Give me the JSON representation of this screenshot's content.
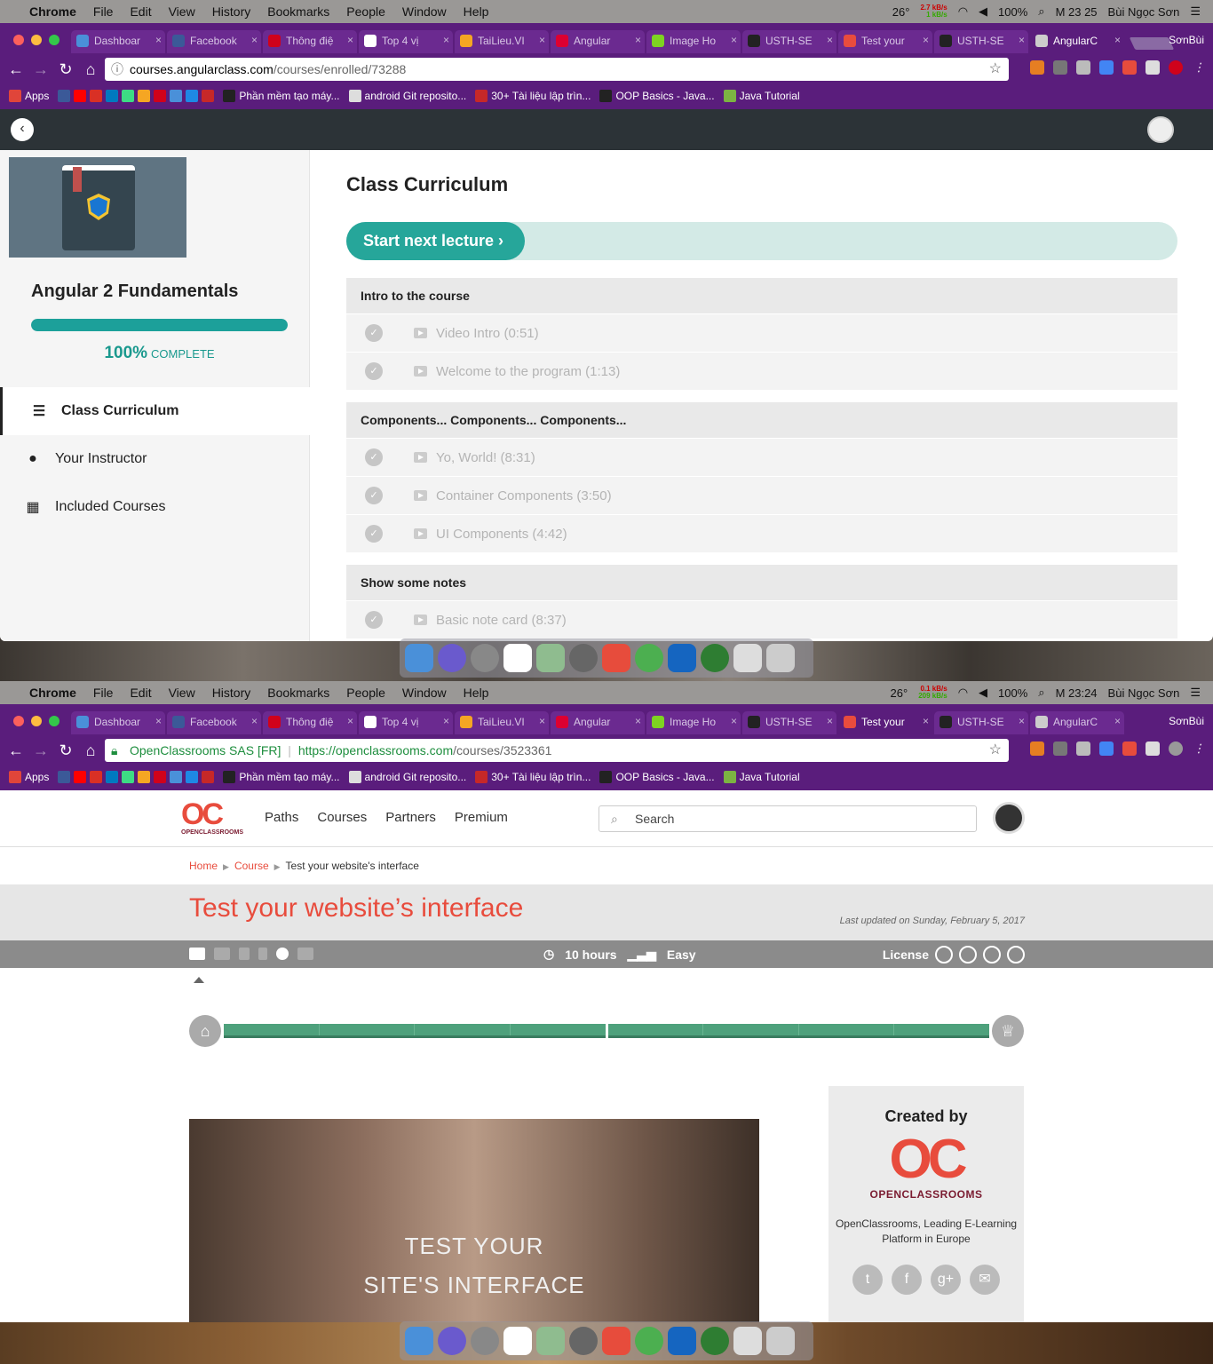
{
  "top": {
    "menubar": {
      "apple": "",
      "items": [
        "Chrome",
        "File",
        "Edit",
        "View",
        "History",
        "Bookmarks",
        "People",
        "Window",
        "Help"
      ],
      "weather": "26°",
      "net_up": "2.7 kB/s",
      "net_down": "1 kB/s",
      "battery": "100%",
      "clock": "M 23 25",
      "user": "Bùi Ngọc Sơn"
    },
    "tabs": [
      {
        "label": "Dashboar",
        "icon_color": "#4a90d9"
      },
      {
        "label": "Facebook",
        "icon_color": "#3b5998"
      },
      {
        "label": "Thông điệ",
        "icon_color": "#d0021b"
      },
      {
        "label": "Top 4 vị",
        "icon_color": "#ffffff"
      },
      {
        "label": "TaiLieu.VI",
        "icon_color": "#f5a623"
      },
      {
        "label": "Angular",
        "icon_color": "#dd0031"
      },
      {
        "label": "Image Ho",
        "icon_color": "#7ed321"
      },
      {
        "label": "USTH-SE",
        "icon_color": "#222222"
      },
      {
        "label": "Test your",
        "icon_color": "#e84c3d"
      },
      {
        "label": "USTH-SE",
        "icon_color": "#222222"
      },
      {
        "label": "AngularC",
        "icon_color": "#cccccc",
        "active": true
      }
    ],
    "profile": "SơnBùi",
    "url": {
      "host": "courses.angularclass.com",
      "path": "/courses/enrolled/73288"
    },
    "bookmarks": [
      "Apps",
      "Phần mềm tạo máy...",
      "android Git reposito...",
      "30+ Tài liệu lập trìn...",
      "OOP Basics - Java...",
      "Java Tutorial"
    ],
    "page": {
      "course_title": "Angular 2 Fundamentals",
      "progress_value": 100,
      "progress_percent": "100%",
      "progress_label": "COMPLETE",
      "sidebar": [
        {
          "label": "Class Curriculum",
          "icon": "list-icon",
          "active": true
        },
        {
          "label": "Your Instructor",
          "icon": "user-icon"
        },
        {
          "label": "Included Courses",
          "icon": "grid-icon"
        }
      ],
      "heading": "Class Curriculum",
      "cta": "Start next lecture  ›",
      "sections": [
        {
          "title": "Intro to the course",
          "lectures": [
            "Video Intro (0:51)",
            "Welcome to the program (1:13)"
          ]
        },
        {
          "title": "Components... Components... Components...",
          "lectures": [
            "Yo, World! (8:31)",
            "Container Components (3:50)",
            "UI Components (4:42)"
          ]
        },
        {
          "title": "Show some notes",
          "lectures": [
            "Basic note card (8:37)"
          ]
        }
      ]
    }
  },
  "bottom": {
    "menubar": {
      "items": [
        "Chrome",
        "File",
        "Edit",
        "View",
        "History",
        "Bookmarks",
        "People",
        "Window",
        "Help"
      ],
      "weather": "26°",
      "net_up": "0.1 kB/s",
      "net_down": "209 kB/s",
      "battery": "100%",
      "clock": "M 23:24",
      "user": "Bùi Ngọc Sơn"
    },
    "tabs": [
      {
        "label": "Dashboar",
        "icon_color": "#4a90d9"
      },
      {
        "label": "Facebook",
        "icon_color": "#3b5998"
      },
      {
        "label": "Thông điệ",
        "icon_color": "#d0021b"
      },
      {
        "label": "Top 4 vị",
        "icon_color": "#ffffff"
      },
      {
        "label": "TaiLieu.VI",
        "icon_color": "#f5a623"
      },
      {
        "label": "Angular",
        "icon_color": "#dd0031"
      },
      {
        "label": "Image Ho",
        "icon_color": "#7ed321"
      },
      {
        "label": "USTH-SE",
        "icon_color": "#222222"
      },
      {
        "label": "Test your",
        "icon_color": "#e84c3d",
        "active": true
      },
      {
        "label": "USTH-SE",
        "icon_color": "#222222"
      },
      {
        "label": "AngularC",
        "icon_color": "#cccccc"
      }
    ],
    "profile": "SơnBùi",
    "url": {
      "secure": "OpenClassrooms SAS [FR]",
      "host": "https://openclassrooms.com",
      "path": "/courses/3523361"
    },
    "bookmarks": [
      "Apps",
      "Phần mềm tạo máy...",
      "android Git reposito...",
      "30+ Tài liệu lập trìn...",
      "OOP Basics - Java...",
      "Java Tutorial"
    ],
    "page": {
      "logo_text": "OPENCLASSROOMS",
      "nav": [
        "Paths",
        "Courses",
        "Partners",
        "Premium"
      ],
      "search_placeholder": "Search",
      "breadcrumb": [
        "Home",
        "Course",
        "Test your website's interface"
      ],
      "title": "Test your website’s interface",
      "updated": "Last updated on Sunday, February 5, 2017",
      "duration": "10 hours",
      "level": "Easy",
      "license": "License",
      "video_text": [
        "TEST YOUR",
        "SITE'S INTERFACE"
      ],
      "created_by": "Created by",
      "creator_name": "OPENCLASSROOMS",
      "creator_desc": "OpenClassrooms, Leading E-Learning Platform in Europe",
      "social": [
        "twitter-icon",
        "facebook-icon",
        "google-plus-icon",
        "email-icon"
      ]
    }
  },
  "colors": {
    "chrome_frame": "#5a1d7c",
    "angular_teal": "#26a69a",
    "oc_red": "#e84c3d",
    "oc_green": "#4ea17c"
  }
}
